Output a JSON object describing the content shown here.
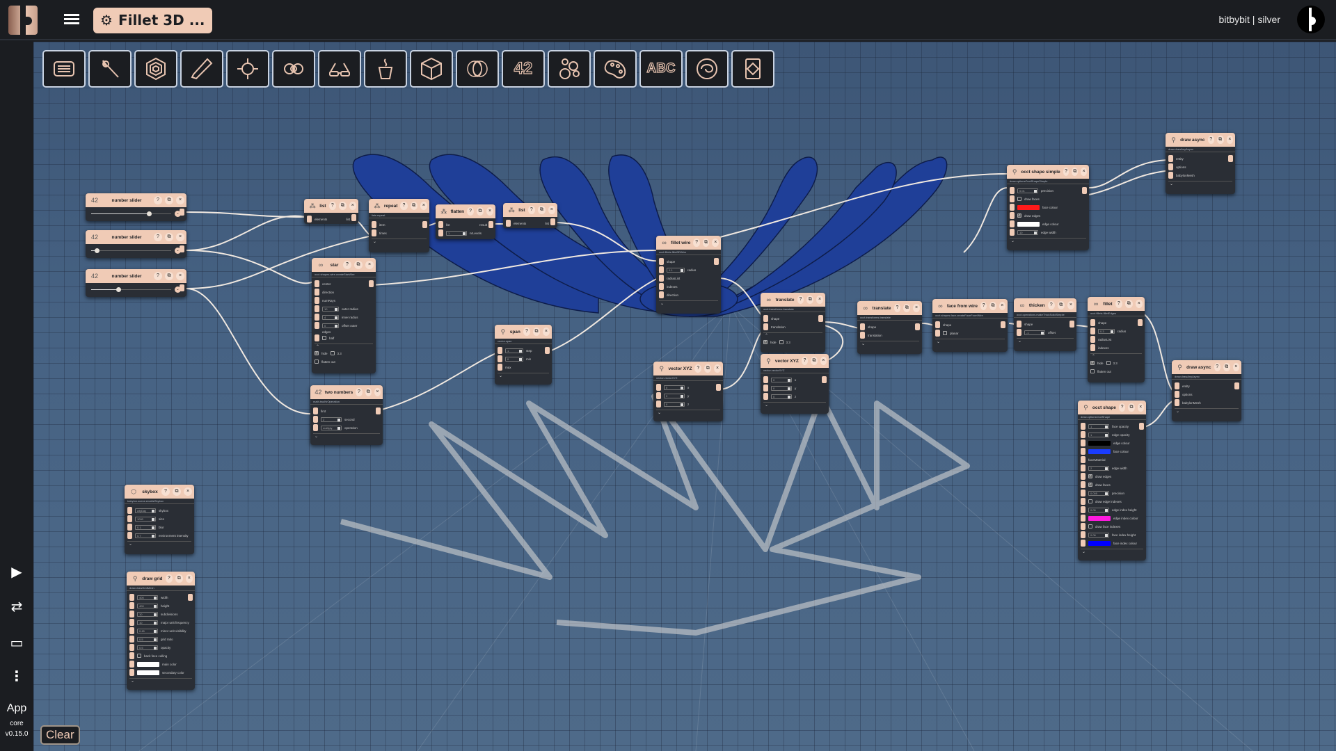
{
  "app": {
    "title": "Fillet 3D ...",
    "user": "bitbybit | silver"
  },
  "sidebar": {
    "app_label": "App",
    "core_label": "core",
    "version": "v0.15.0",
    "items": [
      {
        "icon": "play-icon",
        "glyph": "▶"
      },
      {
        "icon": "swap-icon",
        "glyph": "⇄"
      },
      {
        "icon": "folder-icon",
        "glyph": "🗀"
      },
      {
        "icon": "more-vertical-icon",
        "glyph": "⋮"
      }
    ]
  },
  "clear_label": "Clear",
  "toolbar": [
    {
      "name": "base-category",
      "icon": "layout-list-icon"
    },
    {
      "name": "draw-category",
      "icon": "torch-icon"
    },
    {
      "name": "occt-category",
      "icon": "hexagon-icon"
    },
    {
      "name": "vector-category",
      "icon": "wand-icon"
    },
    {
      "name": "point-category",
      "icon": "target-icon"
    },
    {
      "name": "wire-category",
      "icon": "infinity-icon"
    },
    {
      "name": "babylon-category",
      "icon": "glasses-icon"
    },
    {
      "name": "jscad-category",
      "icon": "cup-icon"
    },
    {
      "name": "manifold-category",
      "icon": "cube-icon"
    },
    {
      "name": "rings-category",
      "icon": "rings-icon"
    },
    {
      "name": "math-category",
      "label": "42"
    },
    {
      "name": "lists-category",
      "icon": "bubbles-icon"
    },
    {
      "name": "color-category",
      "icon": "palette-icon"
    },
    {
      "name": "text-category",
      "label": "ABC"
    },
    {
      "name": "logic-category",
      "icon": "swirl-icon"
    },
    {
      "name": "json-category",
      "icon": "document-icon"
    }
  ],
  "nodes": {
    "slider1": {
      "title": "number slider",
      "value_fraction": 0.72
    },
    "slider2": {
      "title": "number slider",
      "value_fraction": 0.07
    },
    "slider3": {
      "title": "number slider",
      "value_fraction": 0.34
    },
    "list1": {
      "title": "list",
      "inputs": [
        "elements"
      ],
      "output": "list"
    },
    "repeat": {
      "title": "repeat",
      "path": "lists.repeat",
      "inputs": [
        "item",
        "times"
      ]
    },
    "flatten": {
      "title": "flatten",
      "inputs": [
        "list",
        "nrLevels"
      ],
      "output": "result",
      "nrLevels": "1"
    },
    "list2": {
      "title": "list",
      "inputs": [
        "elements"
      ],
      "output": "list"
    },
    "star": {
      "title": "star",
      "path": "occt.shapes.wire.createStarWire",
      "inputs": [
        "center",
        "direction",
        "numRays",
        "outer radius",
        "inner radius",
        "offset outer",
        "edges",
        "half"
      ],
      "outer_radius": "10",
      "inner_radius": "4",
      "offset_outer": "0",
      "half_label": "half",
      "hide_label": "hide",
      "expand_label": "3.3",
      "flatten_label": "flatten out"
    },
    "two_numbers": {
      "title": "two numbers",
      "path": "math.twoNrOperation",
      "inputs": [
        "first",
        "second",
        "operation"
      ],
      "second": "2",
      "operation": "multiply"
    },
    "span": {
      "title": "span",
      "path": "vector.span",
      "inputs": [
        "step",
        "min",
        "max"
      ],
      "step": "1",
      "min": "0"
    },
    "fillet_wire": {
      "title": "fillet wire",
      "path": "occt.fillets.fillet3DWire",
      "inputs": [
        "shape",
        "radius",
        "radiusList",
        "indexes",
        "direction"
      ],
      "radius": "1.1"
    },
    "translate1": {
      "title": "translate",
      "path": "occt.transforms.translate",
      "inputs": [
        "shape",
        "translation"
      ],
      "hide_label": "hide",
      "expand_label": "3.3"
    },
    "vector1": {
      "title": "vector XYZ",
      "path": "vector.vectorXYZ",
      "inputs": [
        "x",
        "y",
        "z"
      ],
      "values": [
        "0",
        "0",
        "0"
      ]
    },
    "vector2": {
      "title": "vector XYZ",
      "path": "vector.vectorXYZ",
      "inputs": [
        "x",
        "y",
        "z"
      ],
      "values": [
        "0",
        "0",
        "0"
      ]
    },
    "translate2": {
      "title": "translate",
      "path": "occt.transforms.translate",
      "inputs": [
        "shape",
        "translation"
      ]
    },
    "face_from_wire": {
      "title": "face from wire",
      "path": "occt.shapes.face.createFaceFromWire",
      "inputs": [
        "shape",
        "planar"
      ]
    },
    "thicken": {
      "title": "thicken",
      "path": "occt.operations.makeThickSolidSimple",
      "inputs": [
        "shape",
        "offset"
      ],
      "offset": "-1"
    },
    "fillet": {
      "title": "fillet",
      "path": "occt.fillets.filletEdges",
      "inputs": [
        "shape",
        "radius",
        "radiusList",
        "indexes"
      ],
      "radius": "0.3",
      "hide_label": "hide",
      "expand_label": "3.3",
      "flatten_label": "flatten out"
    },
    "occt_shape_simple": {
      "title": "occt shape simple",
      "path": "draw.optionsOcctShapeSimple",
      "inputs": [
        "precision",
        "draw faces",
        "face colour",
        "draw edges",
        "edge colour",
        "edge width"
      ],
      "precision": "0.01",
      "edge_width": "10",
      "face_colour": "#ff1a1a",
      "edge_colour": "#ffffff"
    },
    "draw_async1": {
      "title": "draw async",
      "path": "draw.drawAnyAsync",
      "inputs": [
        "entity",
        "options",
        "babylonMesh"
      ]
    },
    "draw_async2": {
      "title": "draw async",
      "path": "draw.drawAnyAsync",
      "inputs": [
        "entity",
        "options",
        "babylonMesh"
      ]
    },
    "occt_shape": {
      "title": "occt shape",
      "path": "draw.optionsOcctShape",
      "inputs": [
        "face opacity",
        "edge opacity",
        "edge colour",
        "face colour",
        "faceMaterial",
        "edge width",
        "draw edges",
        "draw faces",
        "precision",
        "draw edge indexes",
        "edge index height",
        "edge index colour",
        "draw face indexes",
        "face index height",
        "face index colour"
      ],
      "face_opacity": "1",
      "edge_opacity": "1",
      "edge_width": "2",
      "precision": "0.005",
      "edge_index_height": "0.06",
      "face_index_height": "0.06",
      "edge_colour": "#000000",
      "face_colour": "#1a3cff",
      "edge_index_colour": "#ff1ae0",
      "face_index_colour": "#0000ff"
    },
    "skybox": {
      "title": "skybox",
      "path": "babylon.scene.enableSkybox",
      "inputs": [
        "skybox",
        "size",
        "blur",
        "environment intensity"
      ],
      "skybox": "cityDay",
      "size": "1000",
      "blur": "0.1",
      "environment": "0.7"
    },
    "draw_grid": {
      "title": "draw grid",
      "path": "draw.drawGridMesh",
      "inputs": [
        "width",
        "height",
        "subdivisions",
        "major unit frequency",
        "minor unit visibility",
        "grid ratio",
        "opacity",
        "back face culling",
        "main color",
        "secondary color"
      ],
      "width": "400",
      "height": "400",
      "subdivisions": "10",
      "major_unit": "10",
      "minor_visibility": "0.45",
      "grid_ratio": "0.5",
      "opacity": "0.5",
      "main_color": "#ffffff",
      "secondary_color": "#ffffff"
    }
  },
  "colors": {
    "accent": "#f0cbb6",
    "dark": "#1b1d21",
    "node_bg": "#2a2e35",
    "shape_blue": "#1f3f98"
  }
}
